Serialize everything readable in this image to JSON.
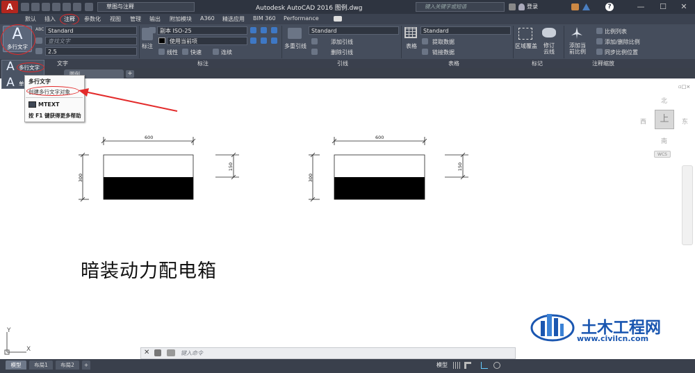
{
  "titlebar": {
    "logo": "A",
    "workspace": "草图与注释",
    "app_title": "Autodesk AutoCAD 2016    图例.dwg",
    "search_placeholder": "键入关键字或短语",
    "login": "登录"
  },
  "tabs": [
    "默认",
    "插入",
    "注释",
    "参数化",
    "视图",
    "管理",
    "输出",
    "附加模块",
    "A360",
    "精选应用",
    "BIM 360",
    "Performance"
  ],
  "ribbon": {
    "text_style": "Standard",
    "find_text_placeholder": "查找文字",
    "text_height": "2.5",
    "dim_style": "副本 ISO-25",
    "dim_layer": "使用当前项",
    "dim_btn": "标注",
    "linear": "线性",
    "quick": "快速",
    "continue": "连续",
    "leader_style": "Standard",
    "mleader_btn": "多重引线",
    "add_leader": "添加引线",
    "remove_leader": "删除引线",
    "table_style": "Standard",
    "table_btn": "表格",
    "extract_data": "提取数据",
    "link_data": "链接数据",
    "wipeout_btn": "区域覆盖",
    "revcloud_btn": "修订云线",
    "add_scale_btn": "添加当前比例",
    "scale_list": "比例列表",
    "add_remove_scale": "添加/删除比例",
    "sync_scale": "同步比例位置",
    "panel_text": "文字",
    "panel_dim": "标注",
    "panel_leader": "引线",
    "panel_table": "表格",
    "panel_markup": "标记",
    "panel_scale": "注释缩放"
  },
  "mtext": {
    "big_label": "多行文字",
    "flyout_item1": "多行文字",
    "flyout_item2": "单行文字"
  },
  "doc_tab": "图例",
  "tooltip": {
    "title": "多行文字",
    "desc": "创建多行文字对象",
    "command": "MTEXT",
    "help": "按 F1 键获得更多帮助"
  },
  "drawing": {
    "dims": {
      "width": "600",
      "height": "300",
      "half": "150"
    },
    "caption": "暗装动力配电箱"
  },
  "viewcube": {
    "north": "北",
    "south": "南",
    "east": "东",
    "west": "西",
    "top": "上",
    "wcs": "WCS"
  },
  "ucs": {
    "x": "X",
    "y": "Y"
  },
  "cmdline": {
    "placeholder": "键入命令"
  },
  "status": {
    "model": "模型",
    "layout1": "布局1",
    "layout2": "布局2",
    "model_btn": "模型"
  },
  "watermark": {
    "title": "土木工程网",
    "url": "www.civilcn.com"
  }
}
